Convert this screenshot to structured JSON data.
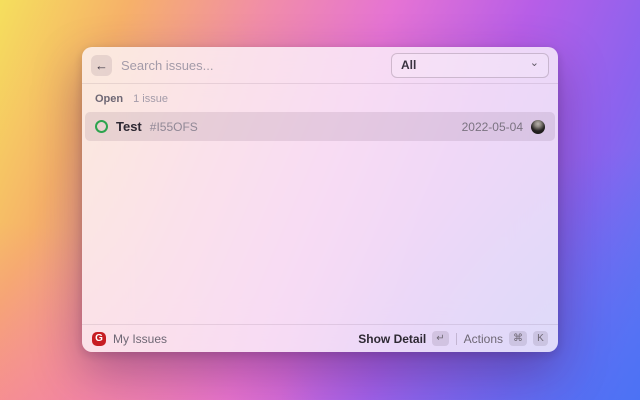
{
  "header": {
    "back_icon": "←",
    "search": {
      "placeholder": "Search issues..."
    },
    "filter": {
      "selected": "All",
      "chevron_icon": "⌄"
    }
  },
  "list": {
    "group_label": "Open",
    "count_label": "1 issue",
    "items": [
      {
        "status": "open",
        "title": "Test",
        "issue_id": "#I55OFS",
        "date": "2022-05-04"
      }
    ]
  },
  "footer": {
    "logo_letter": "G",
    "context_label": "My Issues",
    "show_detail_label": "Show Detail",
    "show_detail_key": "↵",
    "actions_label": "Actions",
    "actions_keys": [
      "⌘",
      "K"
    ]
  },
  "colors": {
    "open_status_green": "#2da44e",
    "logo_red": "#c71d23",
    "panel_background": "rgba(252,246,251,0.80)",
    "selected_row_background": "rgba(96,74,96,0.135)"
  }
}
